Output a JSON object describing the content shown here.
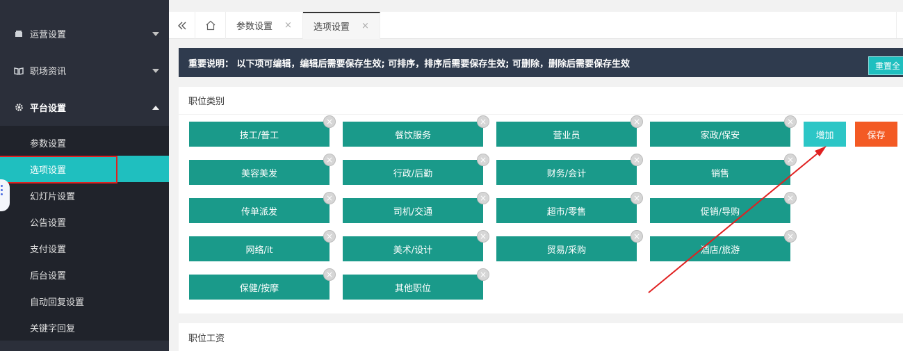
{
  "sidebar": {
    "groups": [
      {
        "label": "运营设置",
        "icon": "box-icon"
      },
      {
        "label": "职场资讯",
        "icon": "book-icon"
      },
      {
        "label": "平台设置",
        "icon": "gear-icon"
      }
    ],
    "sub_items": [
      "参数设置",
      "选项设置",
      "幻灯片设置",
      "公告设置",
      "支付设置",
      "后台设置",
      "自动回复设置",
      "关键字回复"
    ]
  },
  "tabs": {
    "items": [
      {
        "label": "参数设置",
        "close": "×"
      },
      {
        "label": "选项设置",
        "close": "×"
      }
    ]
  },
  "notice": {
    "text": "重要说明： 以下项可编辑，编辑后需要保存生效; 可排序，排序后需要保存生效; 可删除，删除后需要保存生效",
    "reset_label": "重置全"
  },
  "panel_categories": {
    "title": "职位类别",
    "tags": [
      "技工/普工",
      "餐饮服务",
      "营业员",
      "家政/保安",
      "美容美发",
      "行政/后勤",
      "财务/会计",
      "销售",
      "传单派发",
      "司机/交通",
      "超市/零售",
      "促销/导购",
      "网络/it",
      "美术/设计",
      "贸易/采购",
      "酒店/旅游",
      "保健/按摩",
      "其他职位"
    ],
    "delete_glyph": "×",
    "add_label": "增加",
    "save_label": "保存"
  },
  "panel_salary": {
    "title": "职位工资"
  },
  "colors": {
    "accent": "#1fbfbf",
    "tag": "#1a9a8a",
    "save": "#f35a24",
    "annotation": "#e02020"
  }
}
